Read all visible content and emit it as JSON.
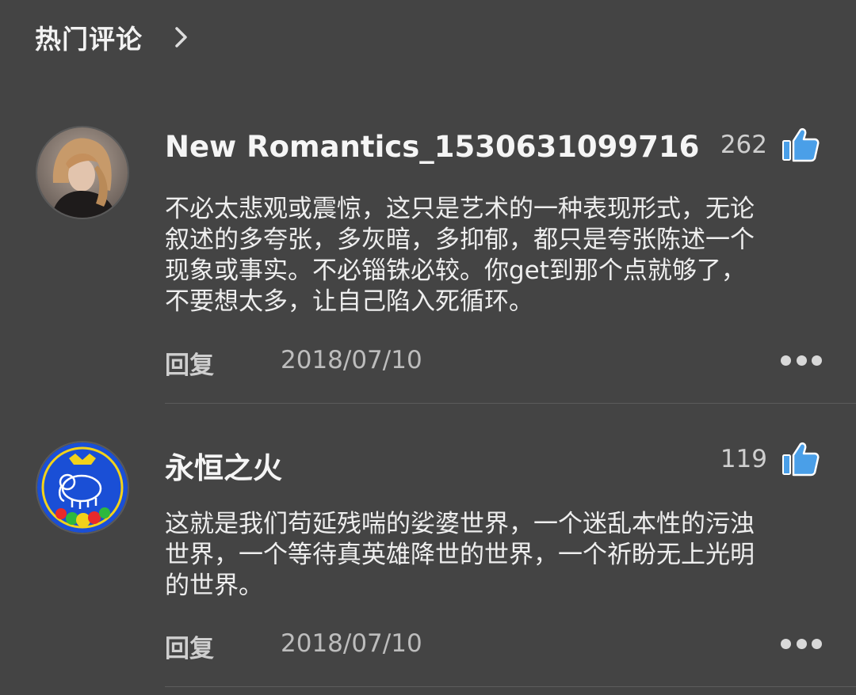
{
  "header": {
    "title": "热门评论",
    "chevron_icon": "chevron-right-icon"
  },
  "comments": [
    {
      "username": "New Romantics_1530631099716",
      "likes": "262",
      "text_lines": [
        "不必太悲观或震惊，这只是艺术的一种表现形式，无论",
        "叙述的多夸张，多灰暗，多抑郁，都只是夸张陈述一个",
        "现象或事实。不必锱铢必较。你get到那个点就够了，",
        "不要想太多，让自己陷入死循环。"
      ],
      "reply_label": "回复",
      "date": "2018/07/10",
      "avatar_icon": "user-avatar-photo",
      "like_icon": "thumbs-up-icon",
      "more_icon": "more-options-icon"
    },
    {
      "username": "永恒之火",
      "likes": "119",
      "text_lines": [
        "这就是我们苟延残喘的娑婆世界，一个迷乱本性的污浊",
        "世界，一个等待真英雄降世的世界，一个祈盼无上光明",
        "的世界。"
      ],
      "reply_label": "回复",
      "date": "2018/07/10",
      "avatar_icon": "elephant-emblem-avatar",
      "like_icon": "thumbs-up-icon",
      "more_icon": "more-options-icon"
    }
  ],
  "colors": {
    "background": "#444444",
    "like_icon": "#4a9fe8",
    "divider": "#5c5c5c"
  }
}
